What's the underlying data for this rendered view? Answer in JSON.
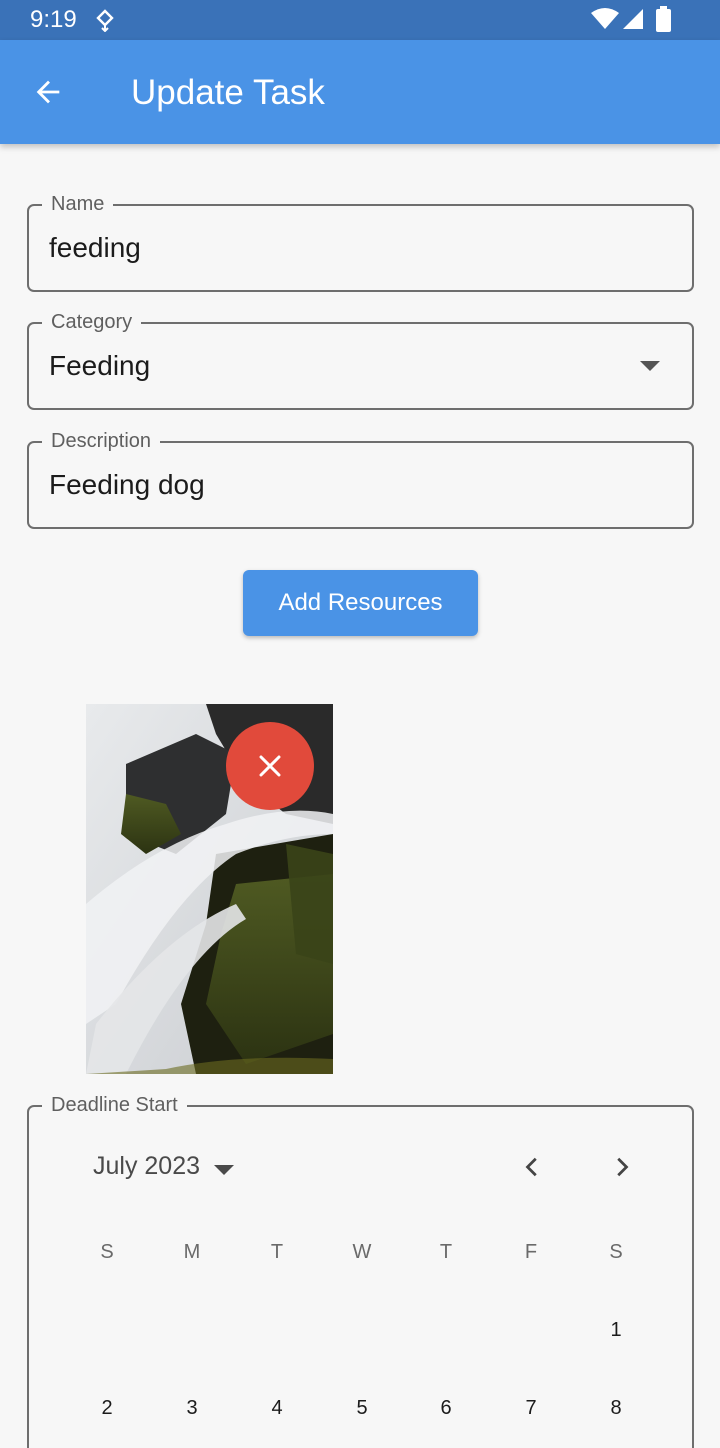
{
  "status_bar": {
    "time": "9:19",
    "icons": [
      "sync-icon",
      "wifi-icon",
      "signal-icon",
      "battery-icon"
    ]
  },
  "app_bar": {
    "title": "Update Task",
    "back_icon": "arrow-back-icon",
    "background": "#4a93e6"
  },
  "form": {
    "name": {
      "label": "Name",
      "value": "feeding"
    },
    "category": {
      "label": "Category",
      "value": "Feeding"
    },
    "description": {
      "label": "Description",
      "value": "Feeding dog"
    },
    "add_resources_label": "Add Resources"
  },
  "resources": {
    "remove_button_color": "#e14a3b"
  },
  "deadline_start": {
    "label": "Deadline Start",
    "month": "July 2023",
    "weekdays": [
      "S",
      "M",
      "T",
      "W",
      "T",
      "F",
      "S"
    ],
    "weeks": [
      [
        "",
        "",
        "",
        "",
        "",
        "",
        "1"
      ],
      [
        "2",
        "3",
        "4",
        "5",
        "6",
        "7",
        "8"
      ]
    ]
  }
}
